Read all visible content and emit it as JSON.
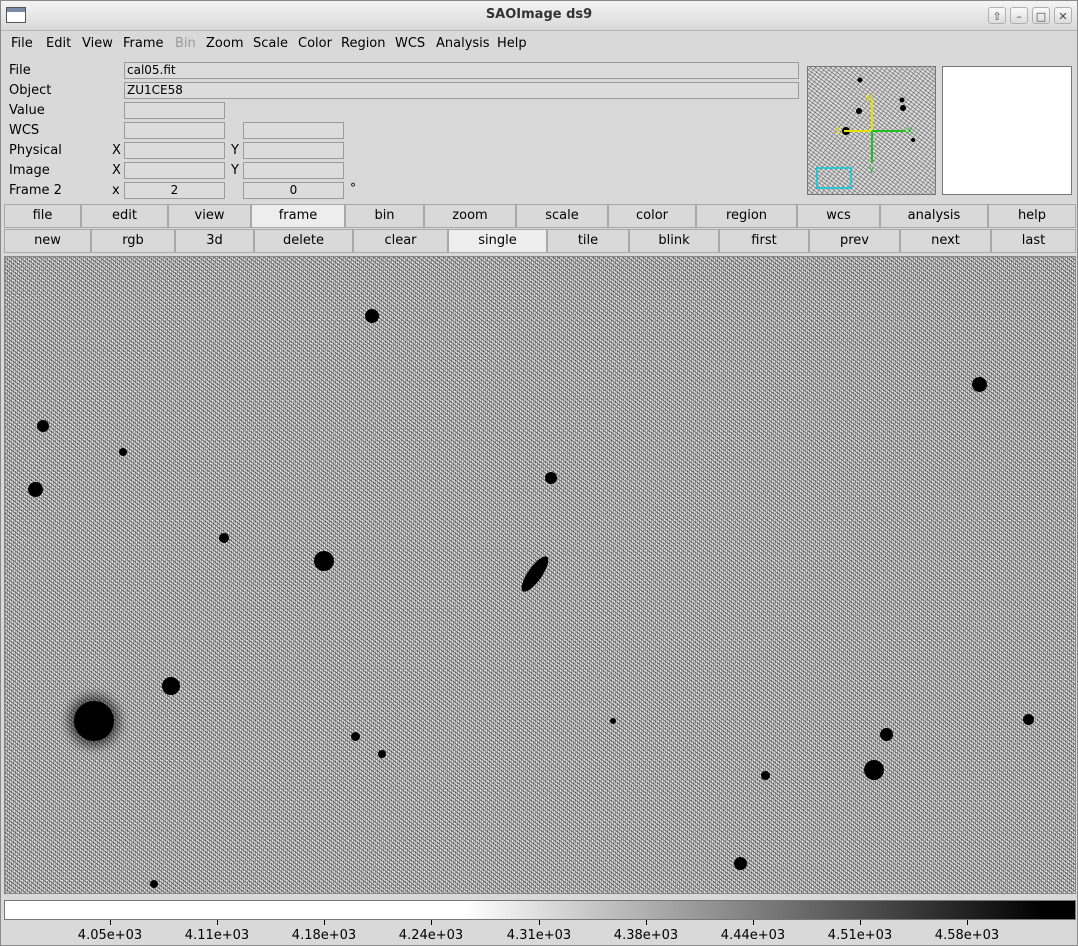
{
  "window": {
    "title": "SAOImage ds9"
  },
  "menubar": {
    "items": [
      "File",
      "Edit",
      "View",
      "Frame",
      "Bin",
      "Zoom",
      "Scale",
      "Color",
      "Region",
      "WCS",
      "Analysis",
      "Help"
    ]
  },
  "info": {
    "file_label": "File",
    "file_value": "cal05.fit",
    "object_label": "Object",
    "object_value": "ZU1CE58",
    "value_label": "Value",
    "wcs_label": "WCS",
    "physical_label": "Physical",
    "physical_x": "X",
    "physical_y": "Y",
    "image_label": "Image",
    "image_x": "X",
    "image_y": "Y",
    "frame_label": "Frame 2",
    "frame_x": "x",
    "frame_zoom": "2",
    "frame_angle": "0",
    "degree": "°"
  },
  "panner": {
    "x_label": "X",
    "y_label": "Y",
    "e_label": "E",
    "n_label": "N"
  },
  "buttonbar": {
    "row1": [
      "file",
      "edit",
      "view",
      "frame",
      "bin",
      "zoom",
      "scale",
      "color",
      "region",
      "wcs",
      "analysis",
      "help"
    ],
    "row2": [
      "new",
      "rgb",
      "3d",
      "delete",
      "clear",
      "single",
      "tile",
      "blink",
      "first",
      "prev",
      "next",
      "last"
    ]
  },
  "colorbar": {
    "colormap": "grey",
    "ticks": [
      "4.05e+03",
      "4.11e+03",
      "4.18e+03",
      "4.24e+03",
      "4.31e+03",
      "4.38e+03",
      "4.44e+03",
      "4.51e+03",
      "4.58e+03"
    ]
  }
}
